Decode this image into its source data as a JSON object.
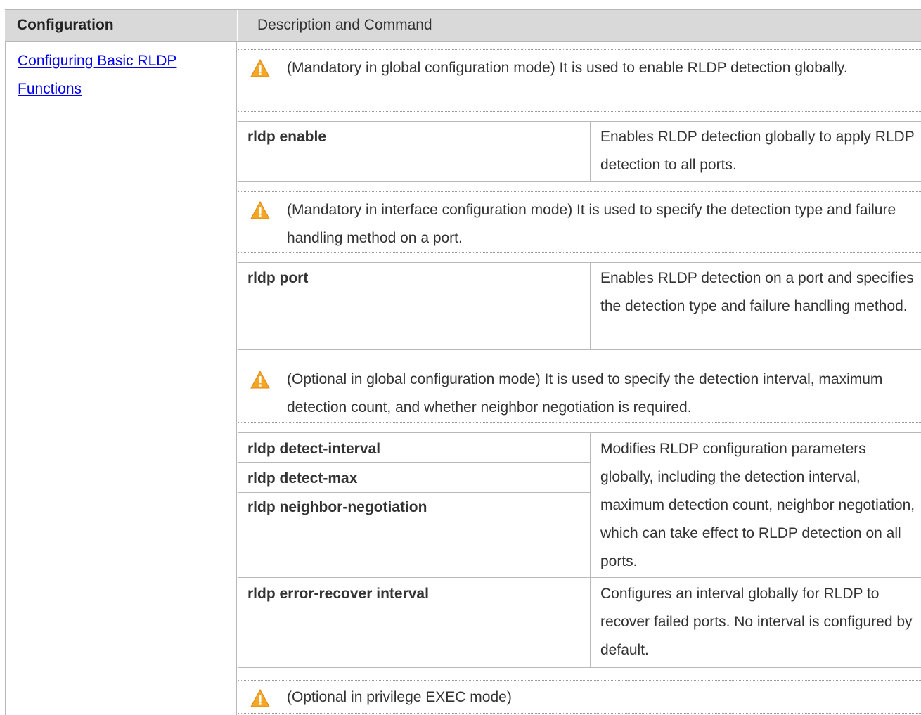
{
  "header": {
    "col1": "Configuration",
    "col2": "Description and Command"
  },
  "left": {
    "link": "Configuring Basic RLDP Functions"
  },
  "notes": [
    {
      "icon": "warning-icon",
      "text": "(Mandatory in global configuration mode) It is used to enable RLDP detection globally."
    },
    {
      "icon": "warning-icon",
      "text": "(Mandatory in interface configuration mode) It is used to specify the detection type and failure handling method on a port."
    },
    {
      "icon": "warning-icon",
      "text": "(Optional in global configuration mode) It is used to specify the detection interval, maximum detection count, and whether neighbor negotiation is required."
    },
    {
      "icon": "warning-icon",
      "text": "(Optional in privilege EXEC mode)"
    }
  ],
  "commands": [
    {
      "names": [
        "rldp enable"
      ],
      "description": "Enables RLDP detection globally to apply RLDP detection to all ports."
    },
    {
      "names": [
        "rldp port"
      ],
      "description": "Enables RLDP detection on a port and specifies the detection type and failure handling method."
    },
    {
      "names": [
        "rldp detect-interval",
        "rldp detect-max",
        "rldp neighbor-negotiation"
      ],
      "description": "Modifies RLDP configuration parameters globally, including the detection interval, maximum detection count, neighbor negotiation, which can take effect to RLDP detection on all ports."
    },
    {
      "names": [
        "rldp error-recover interval"
      ],
      "description": "Configures an interval globally for RLDP to recover failed ports. No interval is configured by default."
    }
  ],
  "colors": {
    "header_bg": "#d9d9d9",
    "link": "#0000ee",
    "warning_fill": "#f5a623"
  }
}
